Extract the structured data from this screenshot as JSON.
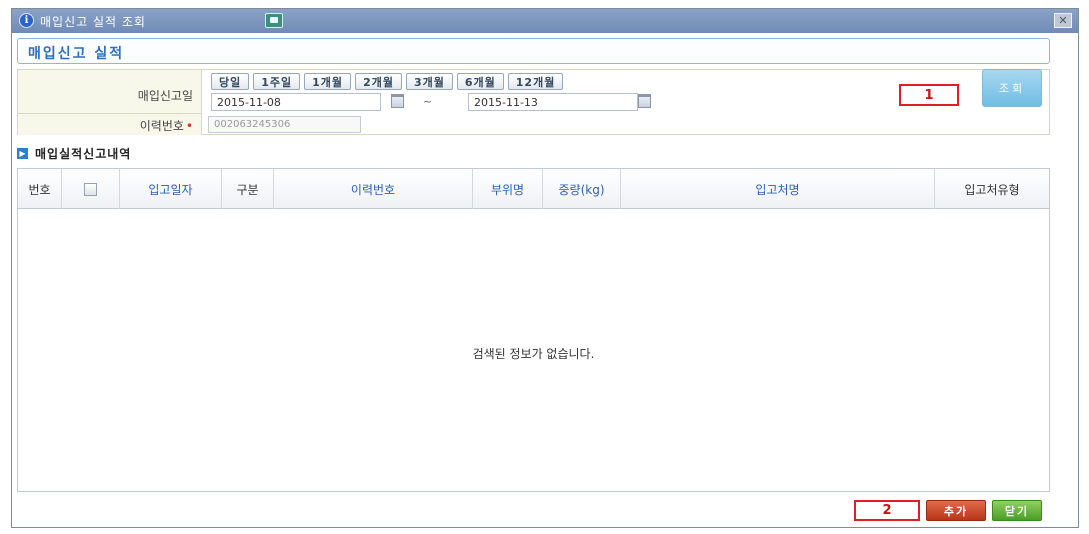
{
  "window": {
    "title": "매입신고 실적 조회",
    "close_symbol": "✕"
  },
  "section": {
    "title": "매입신고 실적"
  },
  "search": {
    "date_label": "매입신고일",
    "quick_ranges": [
      "당일",
      "1주일",
      "1개월",
      "2개월",
      "3개월",
      "6개월",
      "12개월"
    ],
    "start_date": "2015-11-08",
    "tilde": "~",
    "end_date": "2015-11-13",
    "history_label": "이력번호",
    "required_mark": "•",
    "history_number": "002063245306",
    "search_button": "조회"
  },
  "markers": {
    "one": "1",
    "two": "2"
  },
  "list": {
    "title": "매입실적신고내역",
    "columns": [
      "번호",
      "",
      "입고일자",
      "구분",
      "이력번호",
      "부위명",
      "중량(kg)",
      "입고처명",
      "입고처유형"
    ],
    "rows": [],
    "empty_message": "검색된 정보가 없습니다."
  },
  "buttons": {
    "add": "추가",
    "close": "닫기"
  },
  "icons": {
    "title": "info-icon",
    "print": "print-icon",
    "close": "close-icon",
    "calendar": "calendar-icon",
    "list": "arrow-right-icon"
  }
}
